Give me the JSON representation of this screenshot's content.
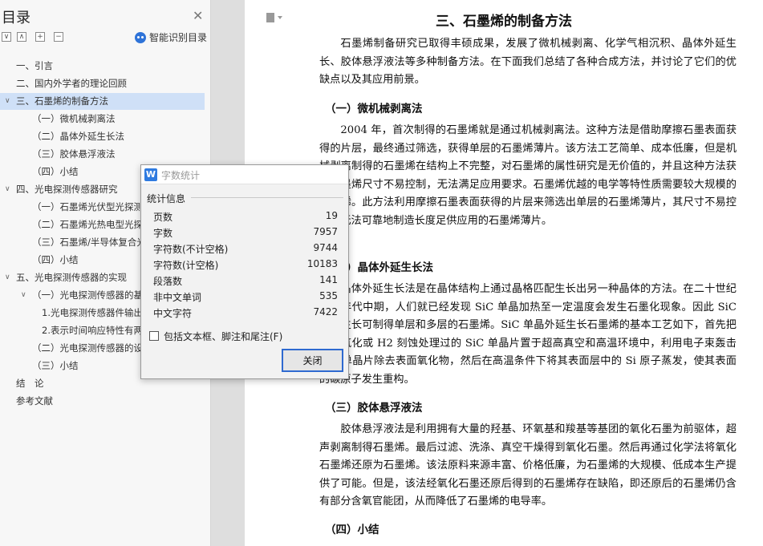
{
  "sidebar": {
    "title": "目录",
    "smart_toc_label": "智能识别目录",
    "toc": [
      {
        "label": "一、引言",
        "level": 0,
        "arrow": ""
      },
      {
        "label": "二、国内外学者的理论回顾",
        "level": 0,
        "arrow": ""
      },
      {
        "label": "三、石墨烯的制备方法",
        "level": 0,
        "arrow": "∨",
        "active": true
      },
      {
        "label": "（一）微机械剥离法",
        "level": 1,
        "arrow": ""
      },
      {
        "label": "（二）晶体外延生长法",
        "level": 1,
        "arrow": ""
      },
      {
        "label": "（三）胶体悬浮液法",
        "level": 1,
        "arrow": ""
      },
      {
        "label": "（四）小结",
        "level": 1,
        "arrow": ""
      },
      {
        "label": "四、光电探测传感器研究",
        "level": 0,
        "arrow": "∨"
      },
      {
        "label": "（一）石墨烯光伏型光探测器",
        "level": 1,
        "arrow": ""
      },
      {
        "label": "（二）石墨烯光热电型光探测器",
        "level": 1,
        "arrow": ""
      },
      {
        "label": "（三）石墨烯/半导体复合光探测器",
        "level": 1,
        "arrow": ""
      },
      {
        "label": "（四）小结",
        "level": 1,
        "arrow": ""
      },
      {
        "label": "五、光电探测传感器的实现",
        "level": 0,
        "arrow": "∨"
      },
      {
        "label": "（一）光电探测传感器的基本结构",
        "level": 1,
        "arrow": "∨"
      },
      {
        "label": "1.光电探测传感器件输出特性",
        "level": 2,
        "arrow": ""
      },
      {
        "label": "2.表示时间响应特性有两种方法",
        "level": 2,
        "arrow": ""
      },
      {
        "label": "（二）光电探测传感器的设计",
        "level": 1,
        "arrow": ""
      },
      {
        "label": "（三）小结",
        "level": 1,
        "arrow": ""
      },
      {
        "label": "结　论",
        "level": 0,
        "arrow": ""
      },
      {
        "label": "参考文献",
        "level": 0,
        "arrow": ""
      }
    ]
  },
  "document": {
    "heading": "三、石墨烯的制备方法",
    "intro": "石墨烯制备研究已取得丰硕成果，发展了微机械剥离、化学气相沉积、晶体外延生长、胶体悬浮液法等多种制备方法。在下面我们总结了各种合成方法，并讨论了它们的优缺点以及其应用前景。",
    "s1_title": "（一）微机械剥离法",
    "s1_text": "2004 年，首次制得的石墨烯就是通过机械剥离法。这种方法是借助摩擦石墨表面获得的片层，最终通过筛选，获得单层的石墨烯薄片。该方法工艺简单、成本低廉，但是机械剥离制得的石墨烯在结构上不完整，对石墨烯的属性研究是无价值的，并且这种方法获得石墨烯尺寸不易控制，无法满足应用要求。石墨烯优越的电学等特性质需要较大规模的石墨烯。此方法利用摩擦石墨表面获得的片层来筛选出单层的石墨烯薄片，其尺寸不易控制，无法可靠地制造长度足供应用的石墨烯薄片。",
    "s2_title": "（二）晶体外延生长法",
    "s2_text": "晶体外延生长法是在晶体结构上通过晶格匹配生长出另一种晶体的方法。在二十世纪九十年代中期，人们就已经发现 SiC 单晶加热至一定温度会发生石墨化现象。因此 SiC 外延生长可制得单层和多层的石墨烯。SiC 单晶外延生长石墨烯的基本工艺如下，首先把经过氧化或 H2 刻蚀处理过的 SiC 单晶片置于超高真空和高温环境中，利用电子束轰击 SiC 单晶片除去表面氧化物，然后在高温条件下将其表面层中的 Si 原子蒸发，使其表面的碳原子发生重构。",
    "s3_title": "（三）胶体悬浮液法",
    "s3_text": "胶体悬浮液法是利用拥有大量的羟基、环氧基和羧基等基团的氧化石墨为前驱体，超声剥离制得石墨烯。最后过滤、洗涤、真空干燥得到氧化石墨。然后再通过化学法将氧化石墨烯还原为石墨烯。该法原料来源丰富、价格低廉，为石墨烯的大规模、低成本生产提供了可能。但是，该法经氧化石墨还原后得到的石墨烯存在缺陷，即还原后的石墨烯仍含有部分含氧官能团，从而降低了石墨烯的电导率。",
    "s4_title": "（四）小结"
  },
  "dialog": {
    "title": "字数统计",
    "section": "统计信息",
    "stats": [
      {
        "key": "页数",
        "value": "19"
      },
      {
        "key": "字数",
        "value": "7957"
      },
      {
        "key": "字符数(不计空格)",
        "value": "9744"
      },
      {
        "key": "字符数(计空格)",
        "value": "10183"
      },
      {
        "key": "段落数",
        "value": "141"
      },
      {
        "key": "非中文单词",
        "value": "535"
      },
      {
        "key": "中文字符",
        "value": "7422"
      }
    ],
    "checkbox_label": "包括文本框、脚注和尾注(F)",
    "checkbox_checked": false,
    "close_label": "关闭",
    "logo_letter": "W"
  },
  "colors": {
    "accent": "#2f7be0",
    "toc_active": "#cfe0f7",
    "button_focus": "#2f6ad0"
  }
}
